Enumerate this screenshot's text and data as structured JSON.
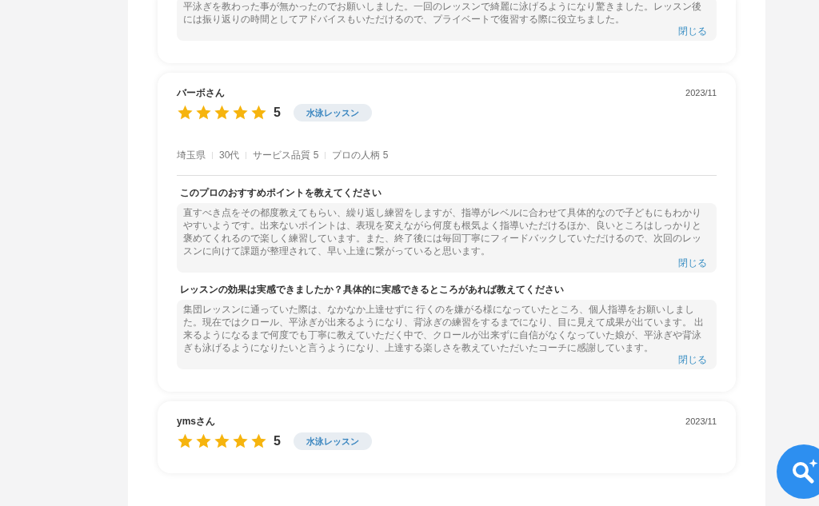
{
  "reviews": [
    {
      "answers": [
        {
          "text": "平泳ぎを教わった事が無かったのでお願いしました。一回のレッスンで綺麗に泳げるようになり驚きました。レッスン後には振り返りの時間としてアドバイスもいただけるので、プライベートで復習する際に役立ちました。",
          "close": "閉じる"
        }
      ]
    },
    {
      "name": "バーボさん",
      "date": "2023/11",
      "stars": 5,
      "score": "5",
      "tag": "水泳レッスン",
      "meta": [
        "埼玉県",
        "30代",
        "サービス品質 5",
        "プロの人柄 5"
      ],
      "answers": [
        {
          "question": "このプロのおすすめポイントを教えてください",
          "text": "直すべき点をその都度教えてもらい、繰り返し練習をしますが、指導がレベルに合わせて具体的なので子どもにもわかりやすいようです。出来ないポイントは、表現を変えながら何度も根気よく指導いただけるほか、良いところはしっかりと褒めてくれるので楽しく練習しています。また、終了後には毎回丁寧にフィードバックしていただけるので、次回のレッスンに向けて課題が整理されて、早い上達に繋がっていると思います。",
          "close": "閉じる"
        },
        {
          "question": "レッスンの効果は実感できましたか？具体的に実感できるところがあれば教えてください",
          "text": "集団レッスンに通っていた際は、なかなか上達せずに 行くのを嫌がる様になっていたところ、個人指導をお願いしました。現在ではクロール、平泳ぎが出来るようになり、背泳ぎの練習をするまでになり、目に見えて成果が出ています。 出来るようになるまで何度でも丁寧に教えていただく中で、クロールが出来ずに自信がなくなっていた娘が、平泳ぎや背泳ぎも泳げるようになりたいと言うようになり、上達する楽しさを教えていただいたコーチに感謝しています。",
          "close": "閉じる"
        }
      ]
    },
    {
      "name": "ymsさん",
      "date": "2023/11",
      "stars": 5,
      "score": "5",
      "tag": "水泳レッスン"
    }
  ]
}
